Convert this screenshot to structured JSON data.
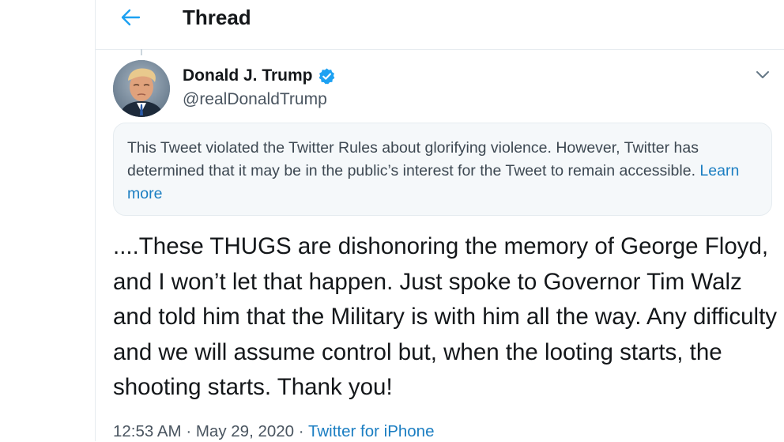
{
  "header": {
    "title": "Thread",
    "back_icon": "arrow-left-icon"
  },
  "colors": {
    "accent": "#1da1f2",
    "link": "#1b7ec2",
    "notice_bg": "#f5f8fa",
    "border": "#e6ecf0"
  },
  "tweet": {
    "author": {
      "display_name": "Donald J. Trump",
      "handle": "@realDonaldTrump",
      "verified_icon": "verified-badge-icon",
      "avatar_icon": "avatar-photo"
    },
    "menu_icon": "chevron-down-icon",
    "notice": {
      "text": "This Tweet violated the Twitter Rules about glorifying violence. However, Twitter has determined that it may be in the public’s interest for the Tweet to remain accessible.",
      "link_label": "Learn more"
    },
    "text": "....These THUGS are dishonoring the memory of George Floyd, and I won’t let that happen. Just spoke to Governor Tim Walz and told him that the Military is with him all the way. Any difficulty and we will assume control but, when the looting starts, the shooting starts. Thank you!",
    "time": "12:53 AM",
    "separator": "·",
    "date": "May 29, 2020",
    "source": "Twitter for iPhone"
  }
}
